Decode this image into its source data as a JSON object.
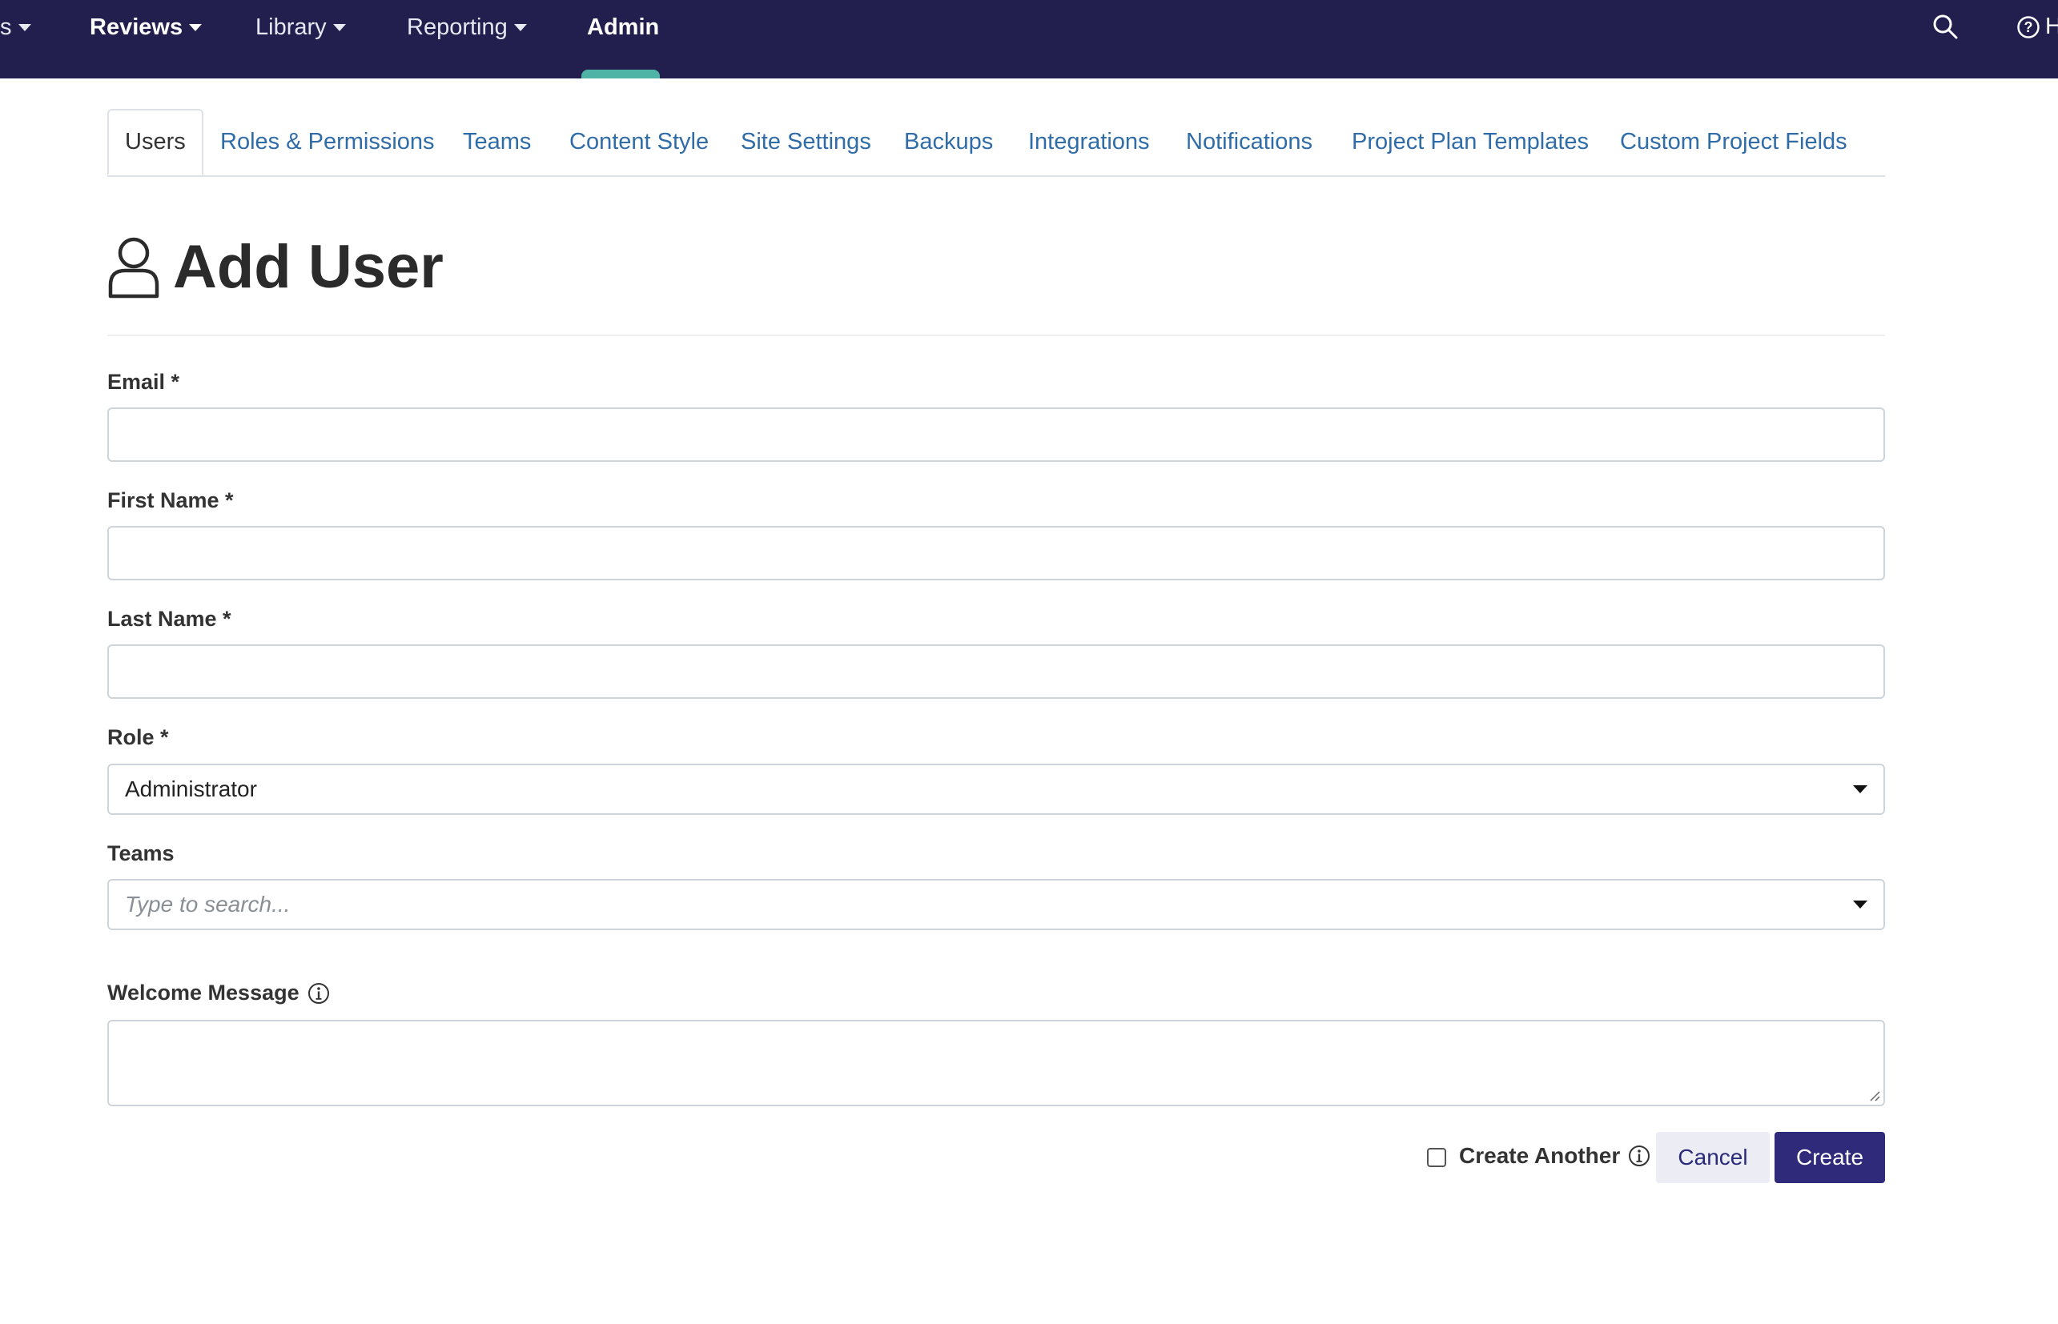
{
  "topnav": {
    "partial_item": "s",
    "items": [
      {
        "label": "Reviews"
      },
      {
        "label": "Library"
      },
      {
        "label": "Reporting"
      },
      {
        "label": "Admin"
      }
    ],
    "help_label": "H"
  },
  "tabs": [
    {
      "label": "Users"
    },
    {
      "label": "Roles & Permissions"
    },
    {
      "label": "Teams"
    },
    {
      "label": "Content Style"
    },
    {
      "label": "Site Settings"
    },
    {
      "label": "Backups"
    },
    {
      "label": "Integrations"
    },
    {
      "label": "Notifications"
    },
    {
      "label": "Project Plan Templates"
    },
    {
      "label": "Custom Project Fields"
    }
  ],
  "page": {
    "title": "Add User"
  },
  "form": {
    "email": {
      "label": "Email *",
      "value": ""
    },
    "first_name": {
      "label": "First Name *",
      "value": ""
    },
    "last_name": {
      "label": "Last Name *",
      "value": ""
    },
    "role": {
      "label": "Role *",
      "value": "Administrator"
    },
    "teams": {
      "label": "Teams",
      "placeholder": "Type to search..."
    },
    "welcome": {
      "label": "Welcome Message",
      "value": ""
    }
  },
  "actions": {
    "create_another_label": "Create Another",
    "cancel_label": "Cancel",
    "create_label": "Create"
  },
  "colors": {
    "nav_bg": "#221f4f",
    "accent": "#4fb3a5",
    "link": "#2f6ca8",
    "primary_button": "#2f2a7a"
  }
}
